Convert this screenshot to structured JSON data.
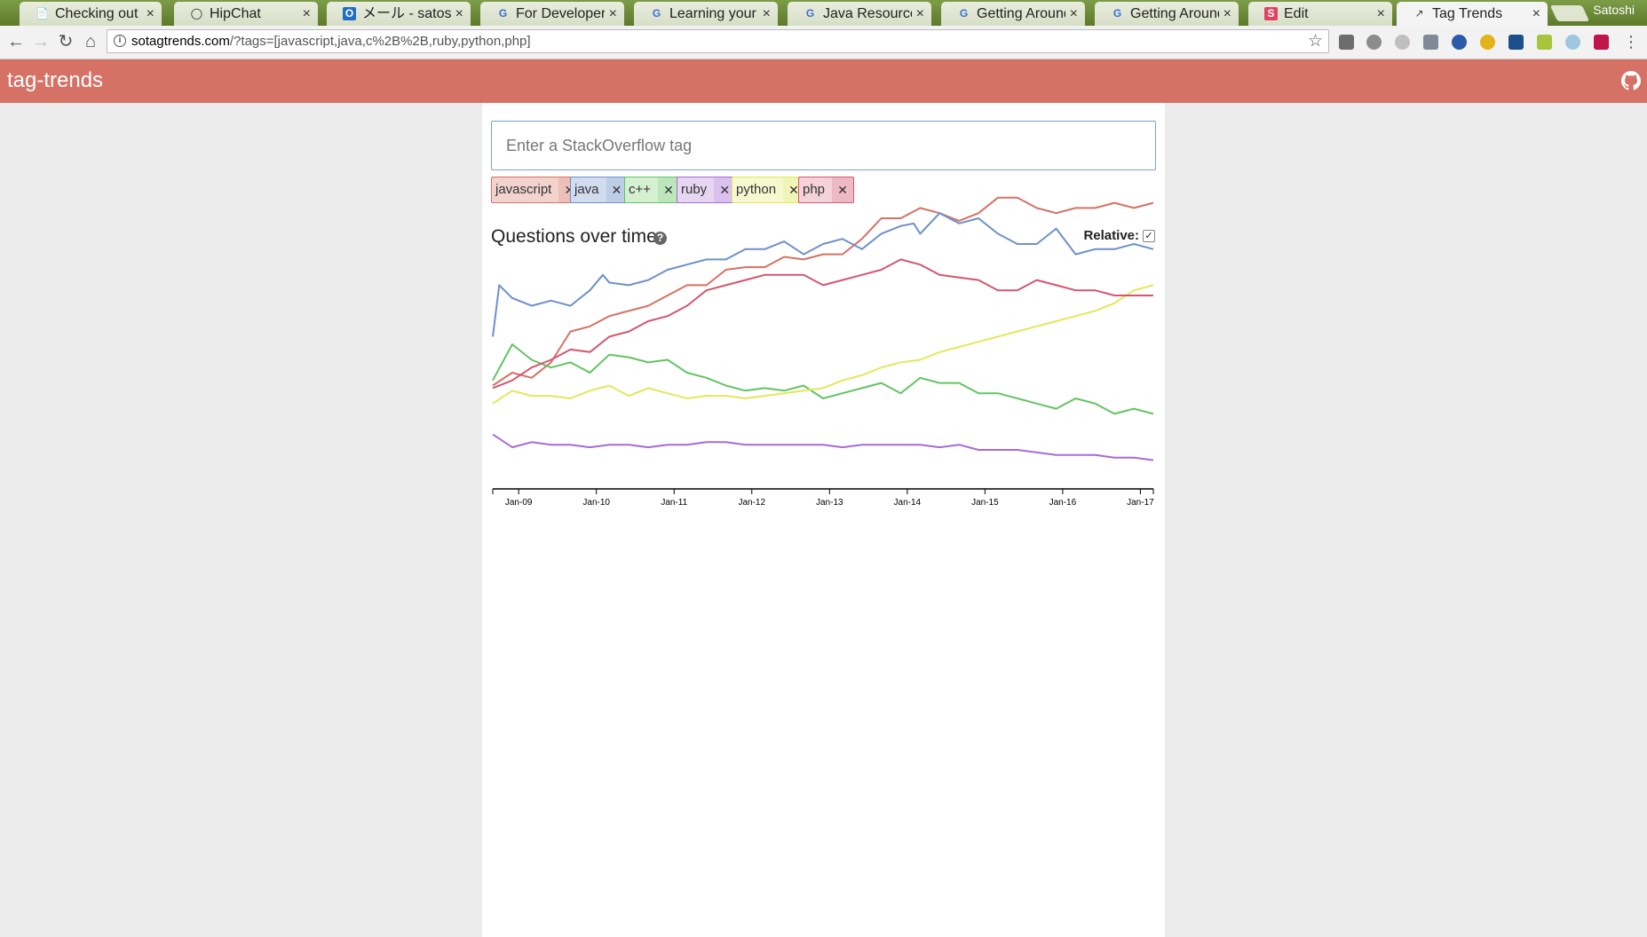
{
  "browser": {
    "tabs": [
      {
        "title": "Checking out an",
        "icon": "page-icon"
      },
      {
        "title": "HipChat",
        "icon": "chat-icon"
      },
      {
        "title": "メール - satoshi.",
        "icon": "outlook-icon"
      },
      {
        "title": "For Developers",
        "icon": "google-icon"
      },
      {
        "title": "Learning your w",
        "icon": "google-icon"
      },
      {
        "title": "Java Resources",
        "icon": "google-icon"
      },
      {
        "title": "Getting Around",
        "icon": "google-icon"
      },
      {
        "title": "Getting Around",
        "icon": "google-icon"
      },
      {
        "title": "Edit",
        "icon": "s-icon"
      },
      {
        "title": "Tag Trends",
        "icon": "trend-icon"
      }
    ],
    "profile_name": "Satoshi",
    "url_host": "sotagtrends.com",
    "url_path": "/?tags=[javascript,java,c%2B%2B,ruby,python,php]"
  },
  "app": {
    "brand": "tag-trends",
    "search_placeholder": "Enter a StackOverflow tag",
    "tags": [
      {
        "label": "javascript",
        "close": "✕",
        "color": "#d67165",
        "bg": "#f2d3cd"
      },
      {
        "label": "java",
        "close": "✕",
        "color": "#6e90c9",
        "bg": "#d1dcee"
      },
      {
        "label": "c++",
        "close": "✕",
        "color": "#62c462",
        "bg": "#d4f0d1"
      },
      {
        "label": "ruby",
        "close": "✕",
        "color": "#a86bd6",
        "bg": "#e6d6f2"
      },
      {
        "label": "python",
        "close": "✕",
        "color": "#e2e85c",
        "bg": "#f6f8cf"
      },
      {
        "label": "php",
        "close": "✕",
        "color": "#d4566e",
        "bg": "#f3d2da"
      }
    ],
    "chart_title": "Questions over time",
    "help_glyph": "?",
    "relative_label": "Relative:",
    "relative_checked": true,
    "github_icon": "github-icon"
  },
  "chart_data": {
    "type": "line",
    "x_start": "Sep-08",
    "x_end": "Mar-17",
    "x_ticks": [
      "Jan-09",
      "Jan-10",
      "Jan-11",
      "Jan-12",
      "Jan-13",
      "Jan-14",
      "Jan-15",
      "Jan-16",
      "Jan-17"
    ],
    "y_axis_shown": false,
    "grid": false,
    "ylim": [
      0,
      100
    ],
    "series": [
      {
        "name": "javascript",
        "color": "#d67165",
        "x": [
          "Sep-08",
          "Dec-08",
          "Mar-09",
          "Jun-09",
          "Sep-09",
          "Dec-09",
          "Mar-10",
          "Jun-10",
          "Sep-10",
          "Dec-10",
          "Mar-11",
          "Jun-11",
          "Sep-11",
          "Dec-11",
          "Mar-12",
          "Jun-12",
          "Sep-12",
          "Dec-12",
          "Mar-13",
          "Jun-13",
          "Sep-13",
          "Dec-13",
          "Mar-14",
          "Jun-14",
          "Sep-14",
          "Dec-14",
          "Mar-15",
          "Jun-15",
          "Sep-15",
          "Dec-15",
          "Mar-16",
          "Jun-16",
          "Sep-16",
          "Dec-16",
          "Mar-17"
        ],
        "values": [
          35,
          40,
          38,
          44,
          56,
          58,
          62,
          64,
          66,
          70,
          74,
          74,
          80,
          81,
          81,
          85,
          84,
          86,
          86,
          92,
          100,
          100,
          104,
          102,
          99,
          102,
          108,
          108,
          104,
          102,
          104,
          104,
          106,
          104,
          106
        ]
      },
      {
        "name": "java",
        "color": "#6e90c9",
        "x": [
          "Sep-08",
          "Oct-08",
          "Dec-08",
          "Mar-09",
          "Jun-09",
          "Sep-09",
          "Dec-09",
          "Feb-10",
          "Mar-10",
          "Jun-10",
          "Sep-10",
          "Dec-10",
          "Mar-11",
          "Jun-11",
          "Sep-11",
          "Dec-11",
          "Mar-12",
          "Jun-12",
          "Sep-12",
          "Dec-12",
          "Mar-13",
          "Jun-13",
          "Sep-13",
          "Dec-13",
          "Feb-14",
          "Mar-14",
          "Jun-14",
          "Sep-14",
          "Dec-14",
          "Mar-15",
          "Jun-15",
          "Sep-15",
          "Dec-15",
          "Mar-16",
          "Jun-16",
          "Sep-16",
          "Dec-16",
          "Mar-17"
        ],
        "values": [
          54,
          74,
          69,
          66,
          68,
          66,
          72,
          78,
          75,
          74,
          76,
          80,
          82,
          84,
          84,
          88,
          88,
          91,
          86,
          90,
          92,
          88,
          94,
          97,
          98,
          94,
          102,
          98,
          100,
          94,
          90,
          90,
          96,
          86,
          88,
          88,
          90,
          88
        ]
      },
      {
        "name": "c++",
        "color": "#62c462",
        "x": [
          "Sep-08",
          "Dec-08",
          "Mar-09",
          "Jun-09",
          "Sep-09",
          "Dec-09",
          "Mar-10",
          "Jun-10",
          "Sep-10",
          "Dec-10",
          "Mar-11",
          "Jun-11",
          "Sep-11",
          "Dec-11",
          "Mar-12",
          "Jun-12",
          "Sep-12",
          "Dec-12",
          "Mar-13",
          "Jun-13",
          "Sep-13",
          "Dec-13",
          "Mar-14",
          "Jun-14",
          "Sep-14",
          "Dec-14",
          "Mar-15",
          "Jun-15",
          "Sep-15",
          "Dec-15",
          "Mar-16",
          "Jun-16",
          "Sep-16",
          "Dec-16",
          "Mar-17"
        ],
        "values": [
          37,
          51,
          45,
          42,
          44,
          40,
          47,
          46,
          44,
          45,
          40,
          38,
          35,
          33,
          34,
          33,
          35,
          30,
          32,
          34,
          36,
          32,
          38,
          36,
          36,
          32,
          32,
          30,
          28,
          26,
          30,
          28,
          24,
          26,
          24
        ]
      },
      {
        "name": "ruby",
        "color": "#a86bd6",
        "x": [
          "Sep-08",
          "Dec-08",
          "Mar-09",
          "Jun-09",
          "Sep-09",
          "Dec-09",
          "Mar-10",
          "Jun-10",
          "Sep-10",
          "Dec-10",
          "Mar-11",
          "Jun-11",
          "Sep-11",
          "Dec-11",
          "Mar-12",
          "Jun-12",
          "Sep-12",
          "Dec-12",
          "Mar-13",
          "Jun-13",
          "Sep-13",
          "Dec-13",
          "Mar-14",
          "Jun-14",
          "Sep-14",
          "Dec-14",
          "Mar-15",
          "Jun-15",
          "Sep-15",
          "Dec-15",
          "Mar-16",
          "Jun-16",
          "Sep-16",
          "Dec-16",
          "Mar-17"
        ],
        "values": [
          16,
          11,
          13,
          12,
          12,
          11,
          12,
          12,
          11,
          12,
          12,
          13,
          13,
          12,
          12,
          12,
          12,
          12,
          11,
          12,
          12,
          12,
          12,
          11,
          12,
          10,
          10,
          10,
          9,
          8,
          8,
          8,
          7,
          7,
          6
        ]
      },
      {
        "name": "python",
        "color": "#e2e85c",
        "x": [
          "Sep-08",
          "Dec-08",
          "Mar-09",
          "Jun-09",
          "Sep-09",
          "Dec-09",
          "Mar-10",
          "Jun-10",
          "Sep-10",
          "Dec-10",
          "Mar-11",
          "Jun-11",
          "Sep-11",
          "Dec-11",
          "Mar-12",
          "Jun-12",
          "Sep-12",
          "Dec-12",
          "Mar-13",
          "Jun-13",
          "Sep-13",
          "Dec-13",
          "Mar-14",
          "Jun-14",
          "Sep-14",
          "Dec-14",
          "Mar-15",
          "Jun-15",
          "Sep-15",
          "Dec-15",
          "Mar-16",
          "Jun-16",
          "Sep-16",
          "Dec-16",
          "Mar-17"
        ],
        "values": [
          28,
          33,
          31,
          31,
          30,
          33,
          35,
          31,
          34,
          32,
          30,
          31,
          31,
          30,
          31,
          32,
          33,
          34,
          37,
          39,
          42,
          44,
          45,
          48,
          50,
          52,
          54,
          56,
          58,
          60,
          62,
          64,
          67,
          72,
          74
        ]
      },
      {
        "name": "php",
        "color": "#d4566e",
        "x": [
          "Sep-08",
          "Dec-08",
          "Mar-09",
          "Jun-09",
          "Sep-09",
          "Dec-09",
          "Mar-10",
          "Jun-10",
          "Sep-10",
          "Dec-10",
          "Mar-11",
          "Jun-11",
          "Sep-11",
          "Dec-11",
          "Mar-12",
          "Jun-12",
          "Sep-12",
          "Dec-12",
          "Mar-13",
          "Jun-13",
          "Sep-13",
          "Dec-13",
          "Mar-14",
          "Jun-14",
          "Sep-14",
          "Dec-14",
          "Mar-15",
          "Jun-15",
          "Sep-15",
          "Dec-15",
          "Mar-16",
          "Jun-16",
          "Sep-16",
          "Dec-16",
          "Mar-17"
        ],
        "values": [
          34,
          37,
          42,
          45,
          49,
          48,
          54,
          56,
          60,
          62,
          66,
          72,
          74,
          76,
          78,
          78,
          78,
          74,
          76,
          78,
          80,
          84,
          82,
          78,
          77,
          76,
          72,
          72,
          76,
          74,
          72,
          72,
          70,
          70,
          70
        ]
      }
    ]
  }
}
